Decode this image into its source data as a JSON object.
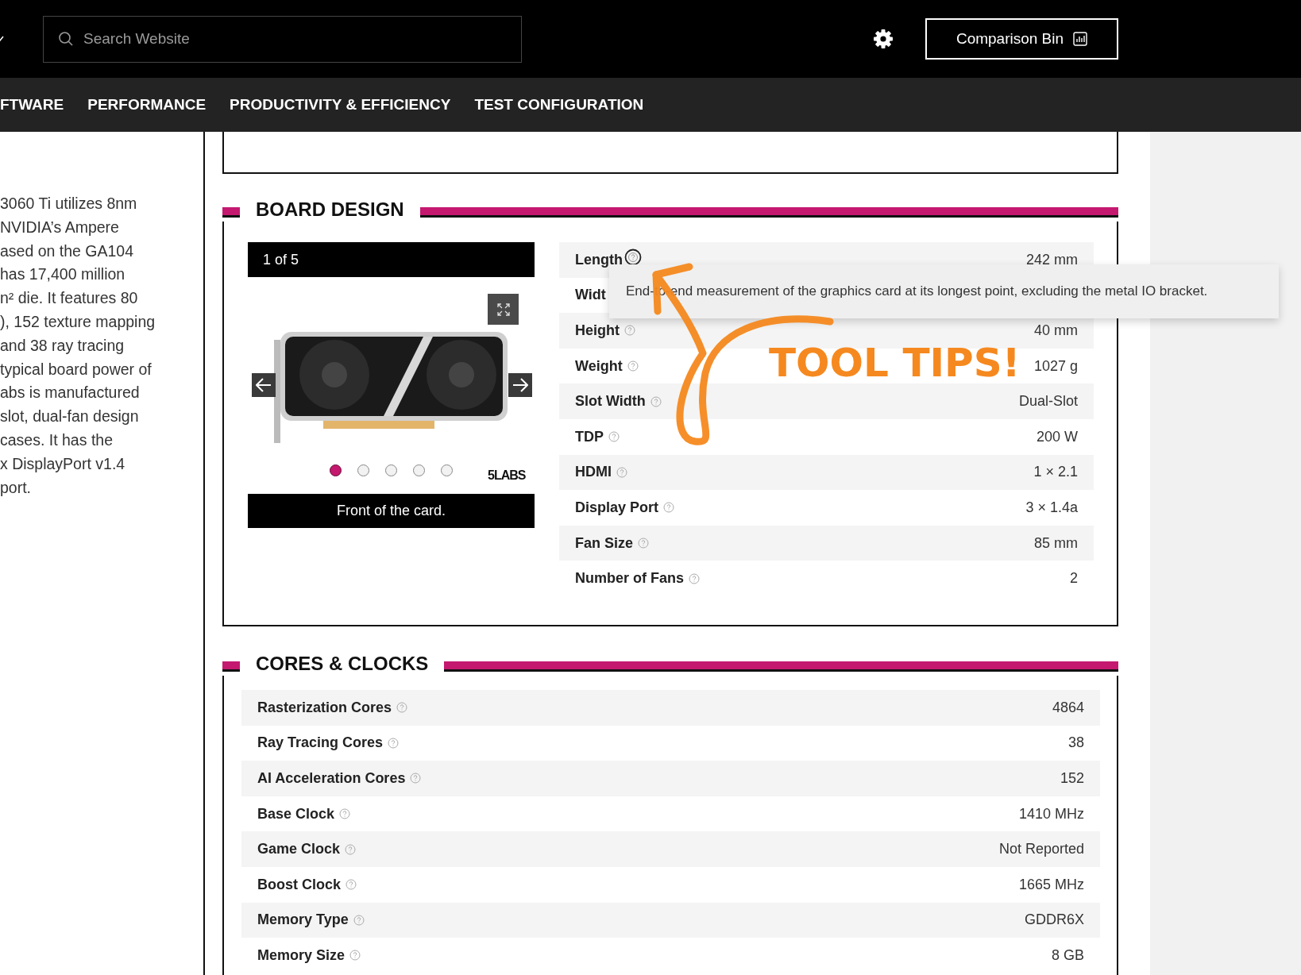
{
  "top_bar": {
    "search": {
      "placeholder": "Search Website"
    },
    "comparison_button": "Comparison Bin"
  },
  "nav": [
    "FTWARE",
    "PERFORMANCE",
    "PRODUCTIVITY & EFFICIENCY",
    "TEST CONFIGURATION"
  ],
  "overview": {
    "lines": [
      "3060 Ti utilizes 8nm",
      "NVIDIA’s Ampere",
      "ased on the GA104",
      "has 17,400 million",
      "n² die. It features 80",
      "), 152 texture mapping",
      "and 38 ray tracing",
      "typical board power of",
      "abs is manufactured",
      "slot, dual-fan design",
      "cases. It has the",
      "x DisplayPort v1.4",
      "port."
    ]
  },
  "board_design": {
    "title": "BOARD DESIGN",
    "carousel": {
      "counter": "1 of 5",
      "dots": [
        {
          "selected": true
        },
        {
          "selected": false
        },
        {
          "selected": false
        },
        {
          "selected": false
        },
        {
          "selected": false
        }
      ],
      "logo": "5LABS",
      "caption": "Front of the card."
    },
    "specs": [
      {
        "label": "Length",
        "value": "242 mm",
        "tooltip_open": true
      },
      {
        "label": "Widt",
        "help_icon": false
      },
      {
        "label": "Height",
        "value": "40 mm",
        "tooltip_open": false
      },
      {
        "label": "Weight",
        "value": "1027 g",
        "tooltip_open": false
      },
      {
        "label": "Slot Width",
        "value": "Dual-Slot",
        "tooltip_open": false
      },
      {
        "label": "TDP",
        "value": "200 W",
        "tooltip_open": false
      },
      {
        "label": "HDMI",
        "value": "1 × 2.1",
        "tooltip_open": false
      },
      {
        "label": "Display Port",
        "value": "3 × 1.4a",
        "tooltip_open": false
      },
      {
        "label": "Fan Size",
        "value": "85 mm",
        "tooltip_open": false
      },
      {
        "label": "Number of Fans",
        "value": "2",
        "tooltip_open": false
      }
    ],
    "tooltip": {
      "text": "End-to-end measurement of the graphics card at its longest point, excluding the metal IO bracket."
    }
  },
  "cores_clocks": {
    "title": "CORES & CLOCKS",
    "specs": [
      {
        "label": "Rasterization Cores",
        "value": "4864"
      },
      {
        "label": "Ray Tracing Cores",
        "value": "38"
      },
      {
        "label": "AI Acceleration Cores",
        "value": "152"
      },
      {
        "label": "Base Clock",
        "value": "1410 MHz"
      },
      {
        "label": "Game Clock",
        "value": "Not Reported"
      },
      {
        "label": "Boost Clock",
        "value": "1665 MHz"
      },
      {
        "label": "Memory Type",
        "value": "GDDR6X"
      },
      {
        "label": "Memory Size",
        "value": "8 GB"
      }
    ]
  },
  "annotation": {
    "text": "TOOL TIPS!"
  }
}
